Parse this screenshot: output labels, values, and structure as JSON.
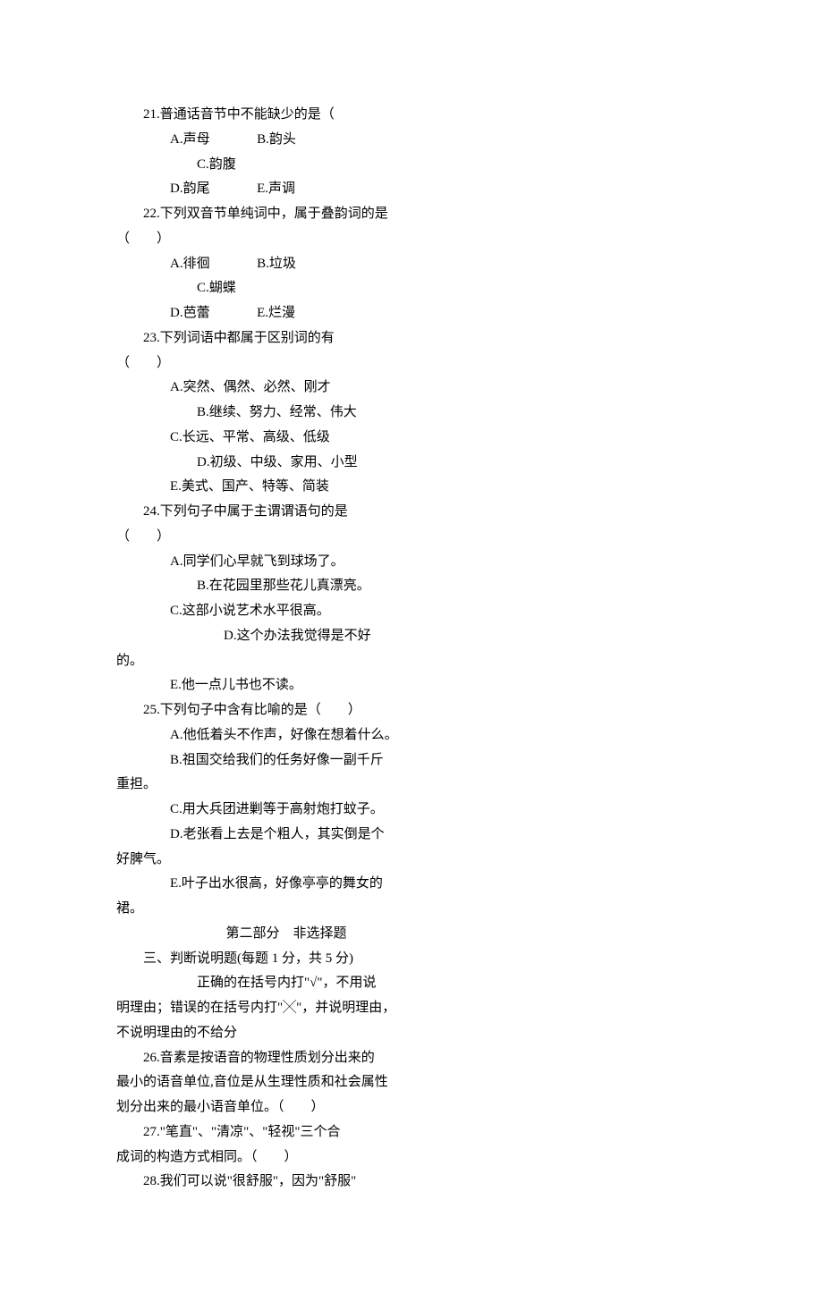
{
  "questions": [
    {
      "stem_lines": [
        {
          "cls": "q-line",
          "text": "21.普通话音节中不能缺少的是（"
        },
        {
          "cls": "flush",
          "text": ""
        }
      ],
      "opts": [
        {
          "cls": "opt-1",
          "text": "A.声母              B.韵头"
        },
        {
          "cls": "opt-2",
          "text": "C.韵腹"
        },
        {
          "cls": "opt-1",
          "text": "D.韵尾              E.声调"
        }
      ]
    },
    {
      "stem_lines": [
        {
          "cls": "q-line",
          "text": "22.下列双音节单纯词中，属于叠韵词的是"
        },
        {
          "cls": "flush",
          "text": "（        ）"
        }
      ],
      "opts": [
        {
          "cls": "opt-1",
          "text": "A.徘徊              B.垃圾"
        },
        {
          "cls": "opt-2",
          "text": "C.蝴蝶"
        },
        {
          "cls": "opt-1",
          "text": "D.芭蕾              E.烂漫"
        }
      ]
    },
    {
      "stem_lines": [
        {
          "cls": "q-line",
          "text": "23.下列词语中都属于区别词的有"
        },
        {
          "cls": "flush",
          "text": "（        ）"
        }
      ],
      "opts": [
        {
          "cls": "opt-1",
          "text": "A.突然、偶然、必然、刚才"
        },
        {
          "cls": "opt-2",
          "text": "B.继续、努力、经常、伟大"
        },
        {
          "cls": "opt-1",
          "text": "C.长远、平常、高级、低级"
        },
        {
          "cls": "opt-2",
          "text": "D.初级、中级、家用、小型"
        },
        {
          "cls": "opt-1",
          "text": "E.美式、国产、特等、简装"
        }
      ]
    },
    {
      "stem_lines": [
        {
          "cls": "q-line",
          "text": "24.下列句子中属于主谓谓语句的是"
        },
        {
          "cls": "flush",
          "text": "（        ）"
        }
      ],
      "opts": [
        {
          "cls": "opt-1",
          "text": "A.同学们心早就飞到球场了。"
        },
        {
          "cls": "opt-2",
          "text": "B.在花园里那些花儿真漂亮。"
        },
        {
          "cls": "opt-1",
          "text": "C.这部小说艺术水平很高。"
        },
        {
          "cls": "opt-3",
          "text": "D.这个办法我觉得是不好"
        },
        {
          "cls": "flush",
          "text": "的。"
        },
        {
          "cls": "opt-1",
          "text": "E.他一点儿书也不读。"
        }
      ]
    },
    {
      "stem_lines": [
        {
          "cls": "q-line",
          "text": "25.下列句子中含有比喻的是（        ）"
        }
      ],
      "opts": [
        {
          "cls": "opt-1",
          "text": "A.他低着头不作声，好像在想着什么。"
        },
        {
          "cls": "opt-1",
          "text": "B.祖国交给我们的任务好像一副千斤"
        },
        {
          "cls": "flush",
          "text": "重担。"
        },
        {
          "cls": "opt-1",
          "text": "C.用大兵团进剿等于高射炮打蚊子。"
        },
        {
          "cls": "opt-1",
          "text": "D.老张看上去是个粗人，其实倒是个"
        },
        {
          "cls": "flush",
          "text": "好脾气。"
        },
        {
          "cls": "opt-1",
          "text": "E.叶子出水很高，好像亭亭的舞女的"
        },
        {
          "cls": "flush",
          "text": "裙。"
        }
      ]
    }
  ],
  "part2_heading": "第二部分    非选择题",
  "section3_title": "三、判断说明题(每题 1 分，共 5 分)",
  "instr_lines": [
    {
      "cls": "opt-2",
      "text": "正确的在括号内打\"√\"，不用说"
    },
    {
      "cls": "flush",
      "text": "明理由；错误的在括号内打\"╳\"，并说明理由，"
    },
    {
      "cls": "flush",
      "text": "不说明理由的不给分"
    }
  ],
  "judgements": [
    {
      "lines": [
        {
          "cls": "q-line",
          "text": "26.音素是按语音的物理性质划分出来的"
        },
        {
          "cls": "flush",
          "text": "最小的语音单位,音位是从生理性质和社会属性"
        },
        {
          "cls": "flush",
          "text": "划分出来的最小语音单位。（        ）"
        }
      ]
    },
    {
      "lines": [
        {
          "cls": "q-line",
          "text": "27.\"笔直\"、\"清凉\"、\"轻视\"三个合"
        },
        {
          "cls": "flush",
          "text": "成词的构造方式相同。（        ）"
        }
      ]
    },
    {
      "lines": [
        {
          "cls": "q-line",
          "text": "28.我们可以说\"很舒服\"，因为\"舒服\""
        }
      ]
    }
  ]
}
